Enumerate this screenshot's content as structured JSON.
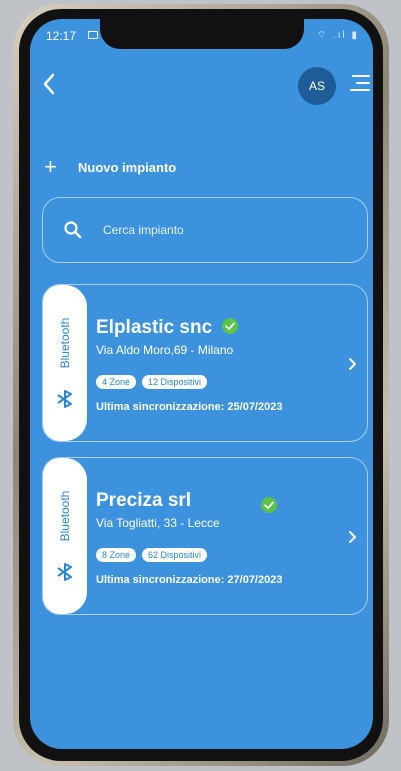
{
  "status_bar": {
    "time": "12:17",
    "right_icons": "⌔ .ıl ▮"
  },
  "header": {
    "avatar_initials": "AS"
  },
  "actions": {
    "new_plant_label": "Nuovo impianto"
  },
  "search": {
    "placeholder": "Cerca impianto"
  },
  "plants": [
    {
      "connection": "Bluetooth",
      "name": "Elplastic snc",
      "verified": true,
      "address": "Via Aldo Moro,69 - Milano",
      "zones": "4 Zone",
      "devices": "12 Dispositivi",
      "last_sync": "Ultima sincronizzazione: 25/07/2023"
    },
    {
      "connection": "Bluetooth",
      "name": "Preciza srl",
      "verified": true,
      "address": "Via Togliatti, 33 - Lecce",
      "zones": "8 Zone",
      "devices": "62 Dispositivi",
      "last_sync": "Ultima sincronizzazione: 27/07/2023"
    }
  ],
  "colors": {
    "screen_bg": "#3d92dd",
    "accent_blue": "#2e86d4",
    "avatar_bg": "#1d5c96",
    "verified_green": "#5cc34a"
  },
  "icons": {
    "back": "chevron-left-icon",
    "menu": "menu-icon",
    "add": "plus-icon",
    "search": "search-icon",
    "bluetooth": "bluetooth-icon",
    "verified": "check-circle-icon",
    "chevron": "chevron-right-icon"
  }
}
